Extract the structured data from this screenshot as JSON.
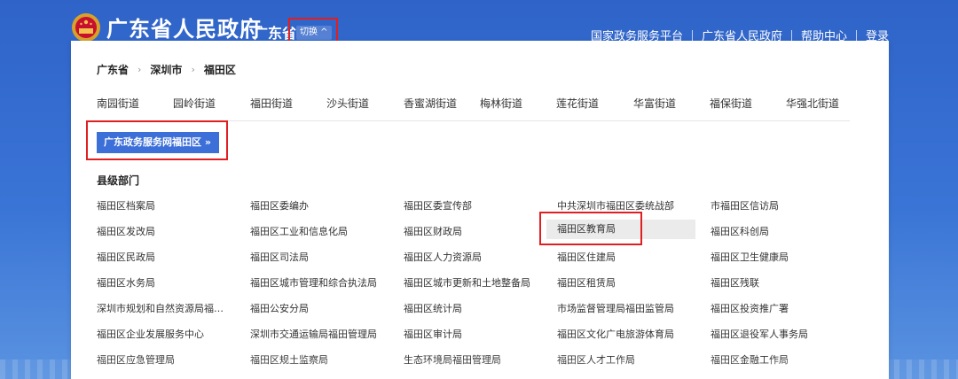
{
  "header": {
    "site_title": "广东省人民政府",
    "region_name": "广东省",
    "switch_label": "切换 ^",
    "links": [
      "国家政务服务平台",
      "广东省人民政府",
      "帮助中心",
      "登录"
    ]
  },
  "panel": {
    "breadcrumb": [
      "广东省",
      "深圳市",
      "福田区"
    ],
    "streets": [
      "南园街道",
      "园岭街道",
      "福田街道",
      "沙头街道",
      "香蜜湖街道",
      "梅林街道",
      "莲花街道",
      "华富街道",
      "福保街道",
      "华强北街道"
    ],
    "portal_button": "广东政务服务网福田区 »",
    "section_title": "县级部门",
    "departments": [
      [
        "福田区档案局",
        "福田区委编办",
        "福田区委宣传部",
        "中共深圳市福田区委统战部",
        "市福田区信访局"
      ],
      [
        "福田区发改局",
        "福田区工业和信息化局",
        "福田区财政局",
        "福田区教育局",
        "福田区科创局"
      ],
      [
        "福田区民政局",
        "福田区司法局",
        "福田区人力资源局",
        "福田区住建局",
        "福田区卫生健康局"
      ],
      [
        "福田区水务局",
        "福田区城市管理和综合执法局",
        "福田区城市更新和土地整备局",
        "福田区租赁局",
        "福田区残联"
      ],
      [
        "深圳市规划和自然资源局福…",
        "福田公安分局",
        "福田区统计局",
        "市场监督管理局福田监管局",
        "福田区投资推广署"
      ],
      [
        "福田区企业发展服务中心",
        "深圳市交通运输局福田管理局",
        "福田区审计局",
        "福田区文化广电旅游体育局",
        "福田区退役军人事务局"
      ],
      [
        "福田区应急管理局",
        "福田区规土监察局",
        "生态环境局福田管理局",
        "福田区人才工作局",
        "福田区金融工作局"
      ]
    ]
  }
}
